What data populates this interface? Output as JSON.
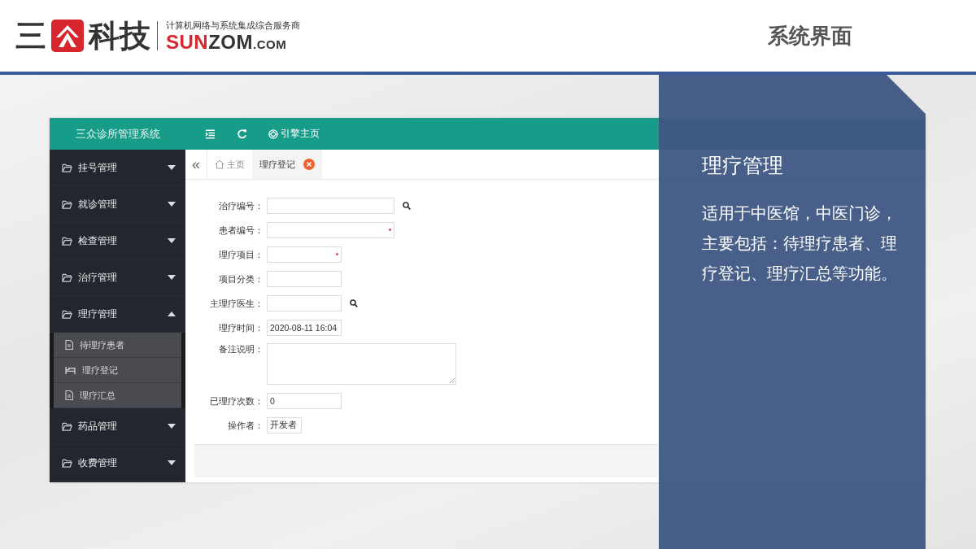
{
  "header": {
    "logo": {
      "mark_left": "三",
      "mark_right": "科技",
      "tagline": "计算机网络与系统集成综合服务商",
      "brand_red": "SUN",
      "brand_dark": "ZOM",
      "brand_suffix": ".COM"
    },
    "title": "系统界面"
  },
  "app": {
    "title": "三众诊所管理系统",
    "toolbar": [
      {
        "kind": "menu"
      },
      {
        "kind": "refresh"
      },
      {
        "kind": "link",
        "label": "引擎主页"
      }
    ],
    "sidebar": {
      "items": [
        {
          "label": "挂号管理",
          "expanded": false
        },
        {
          "label": "就诊管理",
          "expanded": false
        },
        {
          "label": "检查管理",
          "expanded": false
        },
        {
          "label": "治疗管理",
          "expanded": false
        },
        {
          "label": "理疗管理",
          "expanded": true,
          "children": [
            {
              "label": "待理疗患者",
              "kind": "file"
            },
            {
              "label": "理疗登记",
              "kind": "bed"
            },
            {
              "label": "理疗汇总",
              "kind": "file"
            }
          ]
        },
        {
          "label": "药品管理",
          "expanded": false
        },
        {
          "label": "收费管理",
          "expanded": false
        }
      ]
    },
    "tab_back": "«",
    "tabs": [
      {
        "label": "主页",
        "kind": "home",
        "selected": false
      },
      {
        "label": "理疗登记",
        "kind": "page",
        "selected": true
      }
    ],
    "form": {
      "fields": [
        {
          "label": "治疗编号：",
          "kind": "wide",
          "search": true,
          "required": false
        },
        {
          "label": "患者编号：",
          "kind": "wide",
          "search": false,
          "required": true
        },
        {
          "label": "理疗项目：",
          "kind": "narrow",
          "search": false,
          "required": true
        },
        {
          "label": "项目分类：",
          "kind": "narrow",
          "search": false,
          "required": false
        },
        {
          "label": "主理疗医生：",
          "kind": "narrow",
          "search": true,
          "required": false
        },
        {
          "label": "理疗时间：",
          "kind": "narrow",
          "value": "2020-08-11 16:04",
          "search": false,
          "required": false
        },
        {
          "label": "备注说明：",
          "kind": "textarea",
          "search": false,
          "required": false
        },
        {
          "label": "已理疗次数：",
          "kind": "narrow",
          "value": "0",
          "search": false,
          "required": false
        },
        {
          "label": "操作者：",
          "kind": "short",
          "value": "开发者",
          "search": false,
          "required": false
        }
      ]
    }
  },
  "overlay": {
    "title": "理疗管理",
    "text": "适用于中医馆，中医门诊，主要包括：待理疗患者、理疗登记、理疗汇总等功能。"
  }
}
